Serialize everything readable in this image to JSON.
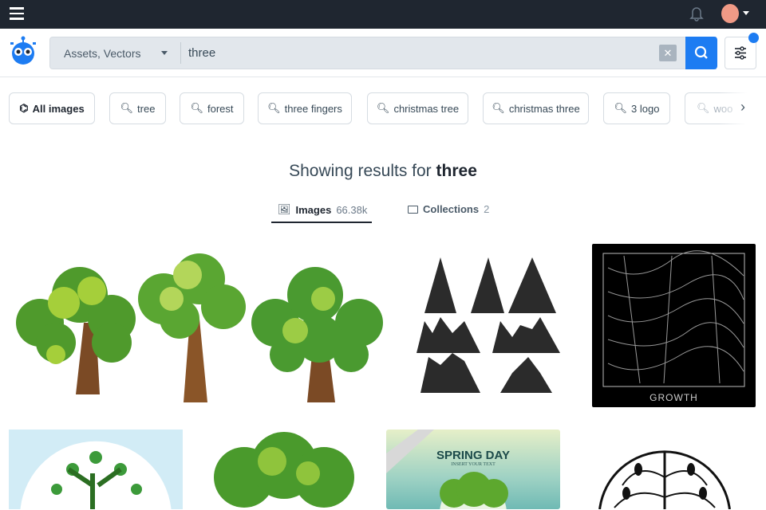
{
  "search": {
    "category": "Assets, Vectors",
    "query": "three"
  },
  "chips": [
    {
      "label": "All images",
      "icon": "all-images-icon"
    },
    {
      "label": "tree"
    },
    {
      "label": "forest"
    },
    {
      "label": "three fingers"
    },
    {
      "label": "christmas tree"
    },
    {
      "label": "christmas three"
    },
    {
      "label": "3 logo"
    },
    {
      "label": "woo"
    }
  ],
  "heading": {
    "prefix": "Showing results for",
    "term": "three"
  },
  "tabs": [
    {
      "label": "Images",
      "count": "66.38k",
      "active": true
    },
    {
      "label": "Collections",
      "count": "2",
      "active": false
    }
  ],
  "results": {
    "growth_label": "GROWTH",
    "spring_title": "SPRING DAY",
    "spring_subtitle": "INSERT YOUR TEXT"
  },
  "colors": {
    "topbar": "#1f2630",
    "accent": "#1d7cf2"
  }
}
